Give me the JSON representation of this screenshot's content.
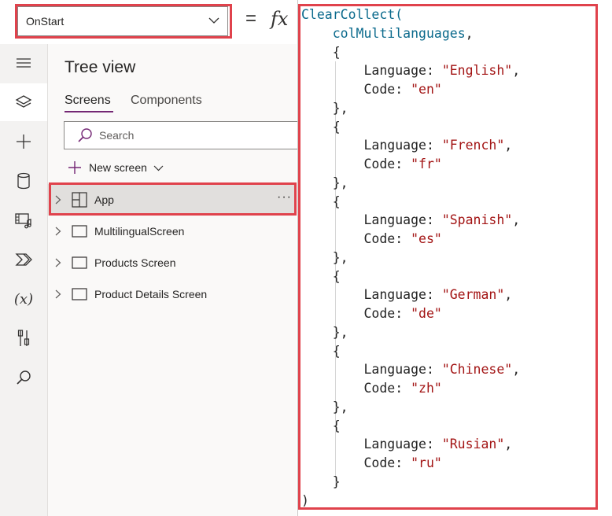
{
  "formula_bar": {
    "property": "OnStart",
    "equals": "=",
    "fx": "fx"
  },
  "rail": {
    "items": [
      "menu-icon",
      "layers-icon",
      "add-icon",
      "data-icon",
      "media-icon",
      "power-automate-icon",
      "variables-icon",
      "tools-icon",
      "search-icon"
    ],
    "variables_label": "(x)"
  },
  "tree": {
    "title": "Tree view",
    "tabs": [
      {
        "label": "Screens",
        "active": true
      },
      {
        "label": "Components",
        "active": false
      }
    ],
    "search_placeholder": "Search",
    "new_screen_label": "New screen",
    "more_label": "···",
    "rows": [
      {
        "label": "App",
        "icon": "app-icon",
        "selected": true
      },
      {
        "label": "MultilingualScreen",
        "icon": "screen-icon",
        "selected": false
      },
      {
        "label": "Products Screen",
        "icon": "screen-icon",
        "selected": false
      },
      {
        "label": "Product Details Screen",
        "icon": "screen-icon",
        "selected": false
      }
    ]
  },
  "code": {
    "function": "ClearCollect(",
    "collection": "colMultilanguages",
    "items": [
      {
        "language": "\"English\"",
        "code": "\"en\""
      },
      {
        "language": "\"French\"",
        "code": "\"fr\""
      },
      {
        "language": "\"Spanish\"",
        "code": "\"es\""
      },
      {
        "language": "\"German\"",
        "code": "\"de\""
      },
      {
        "language": "\"Chinese\"",
        "code": "\"zh\""
      },
      {
        "language": "\"Rusian\"",
        "code": "\"ru\""
      }
    ],
    "closing": ")"
  },
  "colors": {
    "highlight": "#e0424c",
    "accent": "#742774",
    "function": "#0b6a8c",
    "string": "#a31515"
  }
}
